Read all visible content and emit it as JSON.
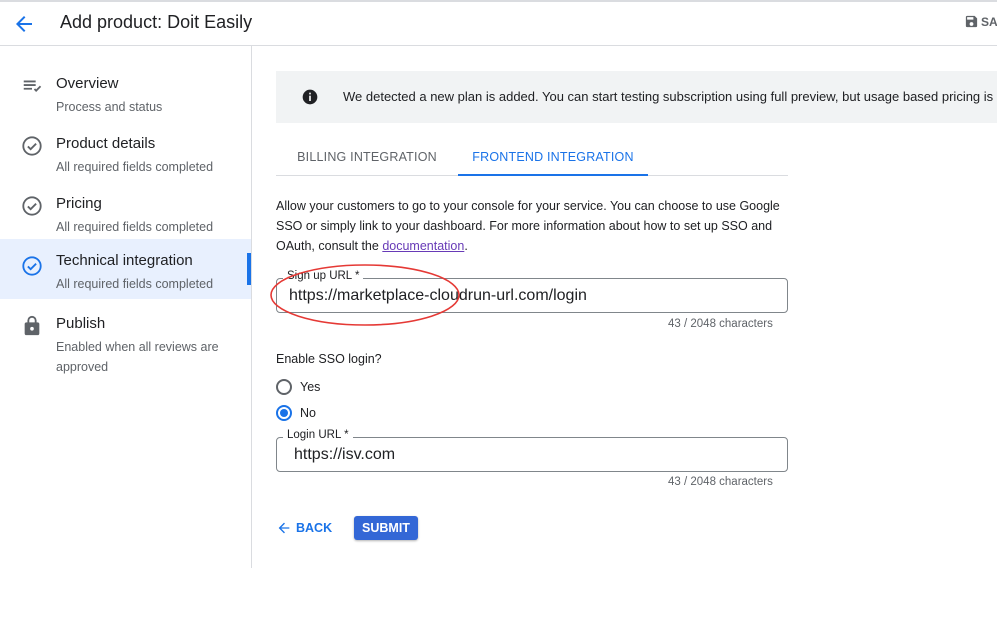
{
  "header": {
    "title": "Add product: Doit Easily",
    "save_label": "SA"
  },
  "sidebar": {
    "items": [
      {
        "label": "Overview",
        "sub": "Process and status",
        "icon": "list-check-icon"
      },
      {
        "label": "Product details",
        "sub": "All required fields completed",
        "icon": "check-circle-icon"
      },
      {
        "label": "Pricing",
        "sub": "All required fields completed",
        "icon": "check-circle-icon"
      },
      {
        "label": "Technical integration",
        "sub": "All required fields completed",
        "icon": "check-circle-icon",
        "active": true
      },
      {
        "label": "Publish",
        "sub": "Enabled when all reviews are approved",
        "icon": "lock-icon"
      }
    ]
  },
  "banner": {
    "text": "We detected a new plan is added. You can start testing subscription using full preview, but usage based pricing is"
  },
  "tabs": [
    {
      "label": "BILLING INTEGRATION",
      "active": false
    },
    {
      "label": "FRONTEND INTEGRATION",
      "active": true
    }
  ],
  "description": {
    "text": "Allow your customers to go to your console for your service. You can choose to use Google SSO or simply link to your dashboard. For more information about how to set up SSO and OAuth, consult the ",
    "link": "documentation",
    "end": "."
  },
  "signup_url": {
    "label": "Sign up URL *",
    "value": "https://marketplace-cloudrun-url.com/login",
    "counter": "43 / 2048 characters"
  },
  "sso": {
    "title": "Enable SSO login?",
    "options": [
      {
        "label": "Yes",
        "checked": false
      },
      {
        "label": "No",
        "checked": true
      }
    ]
  },
  "login_url": {
    "label": "Login URL *",
    "value": "https://isv.com",
    "counter": "43 / 2048 characters"
  },
  "actions": {
    "back_label": "BACK",
    "submit_label": "SUBMIT"
  },
  "colors": {
    "accent": "#1a73e8",
    "submit": "#3367d6",
    "annotation": "#e53935"
  }
}
